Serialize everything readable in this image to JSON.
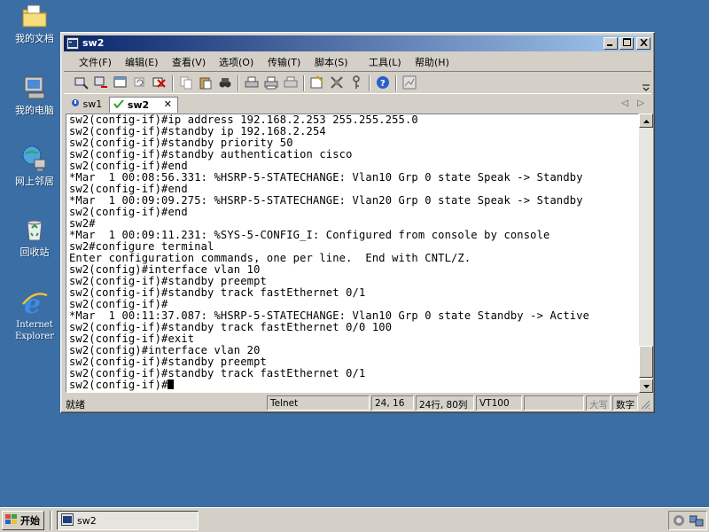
{
  "desktop": {
    "icons": [
      {
        "label": "我的文档",
        "icon": "folder-documents-icon"
      },
      {
        "label": "我的电脑",
        "icon": "computer-icon"
      },
      {
        "label": "网上邻居",
        "icon": "network-icon"
      },
      {
        "label": "回收站",
        "icon": "recycle-bin-icon"
      },
      {
        "label": "Internet Explorer",
        "icon": "internet-explorer-icon"
      }
    ]
  },
  "window": {
    "title": "sw2",
    "menus": [
      "文件(F)",
      "编辑(E)",
      "查看(V)",
      "选项(O)",
      "传输(T)",
      "脚本(S)",
      "工具(L)",
      "帮助(H)"
    ],
    "tabs": [
      {
        "label": "sw1",
        "active": false
      },
      {
        "label": "sw2",
        "active": true
      }
    ],
    "terminal_lines": [
      "sw2(config-if)#ip address 192.168.2.253 255.255.255.0",
      "sw2(config-if)#standby ip 192.168.2.254",
      "sw2(config-if)#standby priority 50",
      "sw2(config-if)#standby authentication cisco",
      "sw2(config-if)#end",
      "*Mar  1 00:08:56.331: %HSRP-5-STATECHANGE: Vlan10 Grp 0 state Speak -> Standby",
      "sw2(config-if)#end",
      "*Mar  1 00:09:09.275: %HSRP-5-STATECHANGE: Vlan20 Grp 0 state Speak -> Standby",
      "sw2(config-if)#end",
      "sw2#",
      "*Mar  1 00:09:11.231: %SYS-5-CONFIG_I: Configured from console by console",
      "sw2#configure terminal",
      "Enter configuration commands, one per line.  End with CNTL/Z.",
      "sw2(config)#interface vlan 10",
      "sw2(config-if)#standby preempt",
      "sw2(config-if)#standby track fastEthernet 0/1",
      "sw2(config-if)#",
      "*Mar  1 00:11:37.087: %HSRP-5-STATECHANGE: Vlan10 Grp 0 state Standby -> Active",
      "sw2(config-if)#standby track fastEthernet 0/0 100",
      "sw2(config-if)#exit",
      "sw2(config)#interface vlan 20",
      "sw2(config-if)#standby preempt",
      "sw2(config-if)#standby track fastEthernet 0/1",
      "sw2(config-if)#"
    ],
    "status": {
      "ready": "就绪",
      "protocol": "Telnet",
      "cursor_pos": "24, 16",
      "size": "24行, 80列",
      "emulation": "VT100",
      "caps": "大写",
      "num": "数字"
    }
  },
  "taskbar": {
    "start_label": "开始",
    "task_label": "sw2"
  },
  "colors": {
    "desktop": "#3a6ea5",
    "title_start": "#0a246a",
    "title_end": "#a6caf0",
    "chrome": "#d4d0c8"
  }
}
